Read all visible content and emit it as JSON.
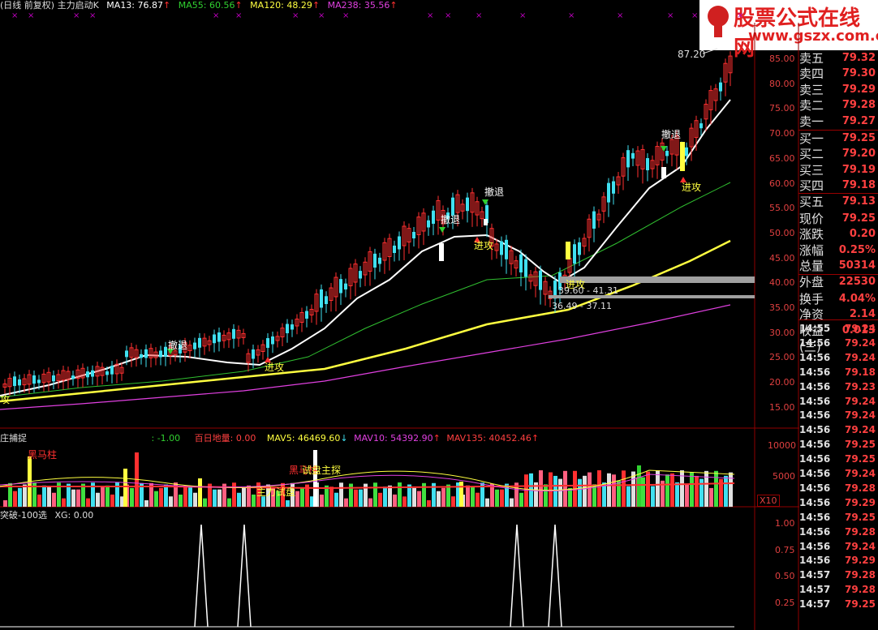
{
  "header": {
    "title": "(日线 前复权) 主力启动K",
    "ma13": "MA13: 76.87",
    "ma55": "MA55: 60.56",
    "ma120": "MA120: 48.29",
    "ma238": "MA238: 35.56",
    "arrow_up": "↑"
  },
  "logo": {
    "cn": "股票公式在线网",
    "url": "www.gszx.com.cn"
  },
  "price_axis": [
    "85.00",
    "80.00",
    "75.00",
    "70.00",
    "65.00",
    "60.00",
    "55.00",
    "50.00",
    "45.00",
    "40.00",
    "35.00",
    "30.00",
    "25.00",
    "20.00",
    "15.00"
  ],
  "annotations": {
    "high_label": "87.20",
    "retreat": "撤退",
    "attack": "进攻",
    "zone1": "39.60 - 41.31",
    "zone2": "36.49 - 37.11",
    "left_label": "攻"
  },
  "volume_header": {
    "name": "庄捕捉",
    "v1": ": -1.00",
    "v2": "百日地量: 0.00",
    "mav5": "MAV5: 46469.60",
    "mav10": "MAV10: 54392.90",
    "mav135": "MAV135: 40452.46",
    "down": "↓",
    "up": "↑"
  },
  "volume_labels": {
    "black_horse": "黑马柱",
    "black_horse2": "黑马柱",
    "main_probe": "主力试盘",
    "probe": "试盘主探"
  },
  "volume_axis": [
    "10000",
    "5000"
  ],
  "volume_unit": "X10",
  "indicator_header": {
    "name": "突破-100选",
    "xg": "XG: 0.00"
  },
  "indicator_axis": [
    "1.00",
    "0.75",
    "0.50",
    "0.25"
  ],
  "quotes": [
    {
      "k": "卖五",
      "v": "79.32"
    },
    {
      "k": "卖四",
      "v": "79.30"
    },
    {
      "k": "卖三",
      "v": "79.29"
    },
    {
      "k": "卖二",
      "v": "79.28"
    },
    {
      "k": "卖一",
      "v": "79.27"
    },
    {
      "k": "买一",
      "v": "79.25"
    },
    {
      "k": "买二",
      "v": "79.20"
    },
    {
      "k": "买三",
      "v": "79.19"
    },
    {
      "k": "买四",
      "v": "79.18"
    },
    {
      "k": "买五",
      "v": "79.13"
    },
    {
      "k": "现价",
      "v": "79.25"
    },
    {
      "k": "涨跌",
      "v": "0.20"
    },
    {
      "k": "涨幅",
      "v": "0.25%"
    },
    {
      "k": "总量",
      "v": "50314"
    },
    {
      "k": "外盘",
      "v": "22530"
    },
    {
      "k": "换手",
      "v": "4.04%"
    },
    {
      "k": "净资",
      "v": "2.14"
    },
    {
      "k": "收益(三)",
      "v": "0.013"
    }
  ],
  "ticks": [
    {
      "t": "14:55",
      "p": "79.24"
    },
    {
      "t": "14:56",
      "p": "79.24"
    },
    {
      "t": "14:56",
      "p": "79.24"
    },
    {
      "t": "14:56",
      "p": "79.18"
    },
    {
      "t": "14:56",
      "p": "79.23"
    },
    {
      "t": "14:56",
      "p": "79.24"
    },
    {
      "t": "14:56",
      "p": "79.24"
    },
    {
      "t": "14:56",
      "p": "79.24"
    },
    {
      "t": "14:56",
      "p": "79.25"
    },
    {
      "t": "14:56",
      "p": "79.25"
    },
    {
      "t": "14:56",
      "p": "79.24"
    },
    {
      "t": "14:56",
      "p": "79.28"
    },
    {
      "t": "14:56",
      "p": "79.29"
    },
    {
      "t": "14:56",
      "p": "79.25"
    },
    {
      "t": "14:56",
      "p": "79.28"
    },
    {
      "t": "14:56",
      "p": "79.24"
    },
    {
      "t": "14:56",
      "p": "79.29"
    },
    {
      "t": "14:57",
      "p": "79.28"
    },
    {
      "t": "14:57",
      "p": "79.28"
    },
    {
      "t": "14:57",
      "p": "79.25"
    }
  ],
  "colors": {
    "up": "#ff3030",
    "down": "#40e0f0",
    "ma13": "#ffffff",
    "ma55": "#30c030",
    "ma120": "#ffff40",
    "ma238": "#e040e0",
    "grid": "#800000"
  }
}
